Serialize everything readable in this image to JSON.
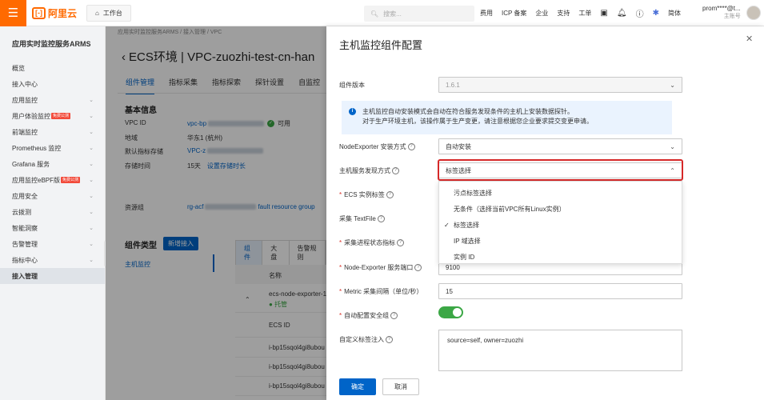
{
  "topbar": {
    "logo_text": "阿里云",
    "workbench": "工作台",
    "search_placeholder": "搜索...",
    "nav": [
      "费用",
      "ICP 备案",
      "企业",
      "支持",
      "工单"
    ],
    "lang": "简体",
    "user": "prom****@t...",
    "role": "主账号"
  },
  "sidebar": {
    "title": "应用实时监控服务ARMS",
    "items": [
      {
        "label": "概览",
        "chevron": false
      },
      {
        "label": "接入中心",
        "chevron": false
      },
      {
        "label": "应用监控",
        "chevron": true
      },
      {
        "label": "用户体验监控",
        "tag": "免费公测",
        "chevron": true
      },
      {
        "label": "前端监控",
        "chevron": true
      },
      {
        "label": "Prometheus 监控",
        "chevron": true
      },
      {
        "label": "Grafana 服务",
        "chevron": true
      },
      {
        "label": "应用监控eBPF版",
        "tag": "免费公测",
        "chevron": true
      },
      {
        "label": "应用安全",
        "chevron": true
      },
      {
        "label": "云拨测",
        "chevron": true
      },
      {
        "label": "智能洞察",
        "chevron": true
      },
      {
        "label": "告警管理",
        "chevron": true
      },
      {
        "label": "指标中心",
        "chevron": true
      },
      {
        "label": "接入管理",
        "chevron": false,
        "active": true
      }
    ]
  },
  "main": {
    "breadcrumb": "应用实时监控服务ARMS  /  接入管理  /  VPC",
    "title": "ECS环境 | VPC-zuozhi-test-cn-han",
    "tabs": [
      "组件管理",
      "指标采集",
      "指标探索",
      "探针设置",
      "自监控"
    ],
    "basic_title": "基本信息",
    "fields": [
      {
        "k": "VPC ID",
        "v": "vpc-bp",
        "status": "可用"
      },
      {
        "k": "地域",
        "v": "华东1 (杭州)"
      },
      {
        "k": "默认指标存储",
        "v": "VPC-z"
      },
      {
        "k": "存储时间",
        "v": "15天",
        "link": "设置存储时长"
      },
      {
        "k": "资源组",
        "v": "rg-acf",
        "v2": "fault resource group"
      }
    ],
    "component_type_title": "组件类型",
    "add_button": "新增接入",
    "left_item": "主机监控",
    "subtabs": [
      "组件",
      "大盘",
      "告警规则"
    ],
    "table_header": "名称",
    "row_name": "ecs-node-exporter-1",
    "row_status": "托管",
    "ecs_id_header": "ECS ID",
    "ecs_rows": [
      "i-bp15sqol4gi8ubou",
      "i-bp15sqol4gi8ubou",
      "i-bp15sqol4gi8ubou",
      "i-bp18aluq84j30ldu"
    ]
  },
  "drawer": {
    "title": "主机监控组件配置",
    "version_label": "组件版本",
    "version_value": "1.6.1",
    "info_line1": "主机监控自动安装模式会自动在符合服务发现条件的主机上安装数据探针。",
    "info_line2": "对于生产环境主机，该操作属于生产变更，请注意根据您企业要求提交变更申请。",
    "node_install_label": "NodeExporter 安装方式",
    "node_install_value": "自动安装",
    "discovery_label": "主机服务发现方式",
    "discovery_value": "标签选择",
    "ecs_tag_label": "ECS 实例标签",
    "textfile_label": "采集 TextFile",
    "process_label": "采集进程状态指标",
    "port_label": "Node-Exporter 服务端口",
    "port_value": "9100",
    "interval_label": "Metric 采集间隔（单位/秒）",
    "interval_value": "15",
    "secgroup_label": "自动配置安全组",
    "custom_tag_label": "自定义标签注入",
    "custom_tag_value": "source=self, owner=zuozhi",
    "ok": "确定",
    "cancel": "取消",
    "dropdown_options": [
      "污点标签选择",
      "无条件（选择当前VPC所有Linux实例）",
      "标签选择",
      "IP 域选择",
      "实例 ID"
    ],
    "dropdown_selected": 2
  }
}
